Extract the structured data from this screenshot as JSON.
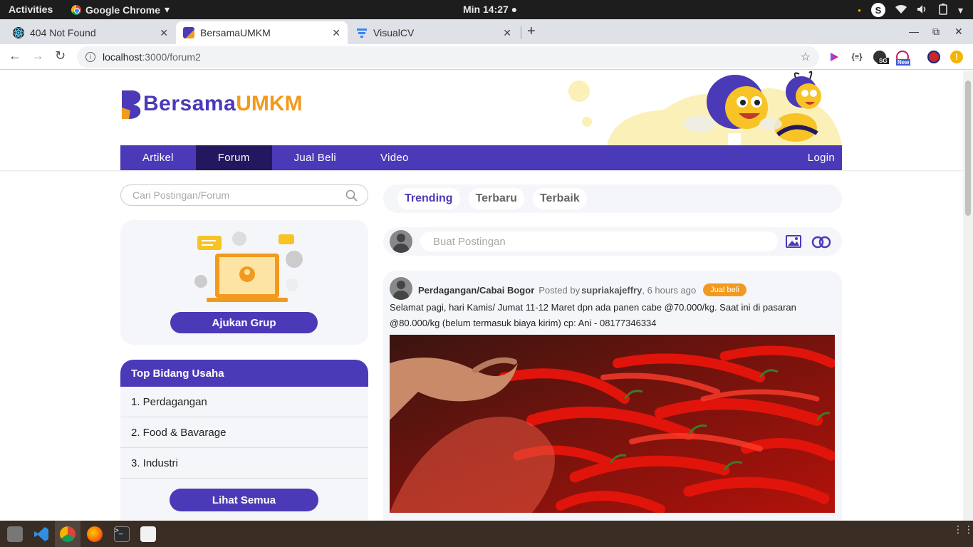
{
  "system_bar": {
    "activities": "Activities",
    "app_name": "Google Chrome",
    "clock": "Min 14:27",
    "skype_letter": "S"
  },
  "tabs": [
    {
      "title": "404 Not Found"
    },
    {
      "title": "BersamaUMKM"
    },
    {
      "title": "VisualCV"
    }
  ],
  "address": {
    "host": "localhost",
    "path": ":3000/forum2"
  },
  "extensions": {
    "sg": "SG",
    "new": "New"
  },
  "site": {
    "logo_part1": "Bersama",
    "logo_part2": "UMKM",
    "nav": [
      "Artikel",
      "Forum",
      "Jual Beli",
      "Video"
    ],
    "login": "Login",
    "search_placeholder": "Cari Postingan/Forum",
    "group_button": "Ajukan Grup",
    "top_title": "Top Bidang Usaha",
    "top_items": [
      "1. Perdagangan",
      "2. Food & Bavarage",
      "3. Industri"
    ],
    "see_all": "Lihat Semua",
    "feed_tabs": [
      "Trending",
      "Terbaru",
      "Terbaik"
    ],
    "compose_placeholder": "Buat Postingan",
    "post": {
      "category": "Perdagangan/Cabai Bogor",
      "posted_by": "Posted by",
      "user": "supriakajeffry",
      "time": ", 6 hours ago",
      "badge": "Jual beli",
      "text": "Selamat pagi, hari Kamis/ Jumat 11-12 Maret dpn ada panen cabe @70.000/kg. Saat ini di pasaran @80.000/kg (belum termasuk biaya kirim) cp: Ani - 08177346334"
    }
  },
  "colors": {
    "brand": "#4a3ab8",
    "brand_dark": "#23185f",
    "accent": "#f29a1f"
  }
}
